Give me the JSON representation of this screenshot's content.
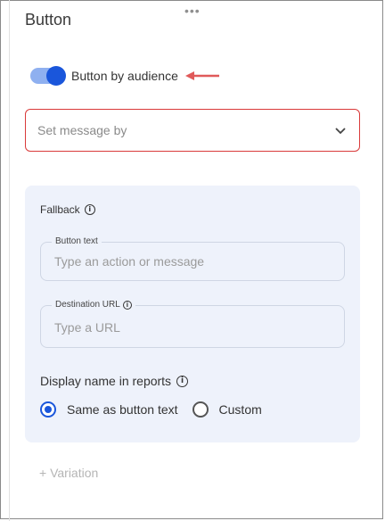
{
  "panel": {
    "title": "Button",
    "drag_handle_icon": "more-horizontal-icon"
  },
  "audience_toggle": {
    "label": "Button by audience",
    "enabled": true,
    "accent_color": "#1a56db"
  },
  "annotation": {
    "icon": "left-arrow-icon",
    "color": "#e05a5a"
  },
  "message_select": {
    "placeholder": "Set message by",
    "border_color": "#d93a3a"
  },
  "fallback": {
    "heading": "Fallback",
    "button_text_field": {
      "label": "Button text",
      "placeholder": "Type an action or message"
    },
    "destination_url_field": {
      "label": "Destination URL",
      "placeholder": "Type a URL"
    },
    "display_name": {
      "heading": "Display name in reports",
      "options": [
        {
          "label": "Same as button text",
          "selected": true
        },
        {
          "label": "Custom",
          "selected": false
        }
      ]
    }
  },
  "add_variation_label": "+ Variation"
}
